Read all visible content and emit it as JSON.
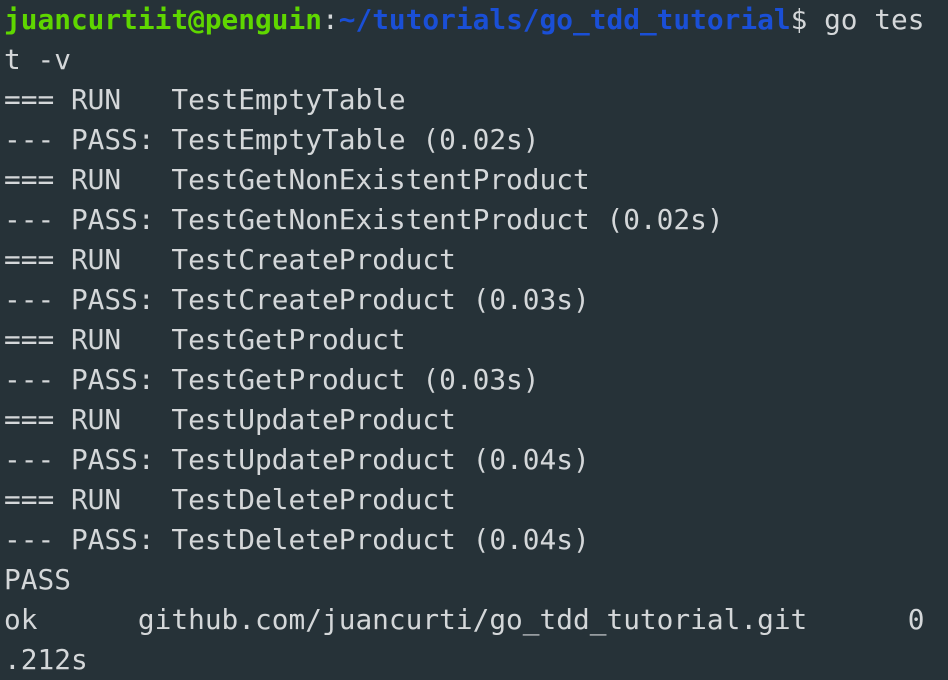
{
  "terminal": {
    "colors": {
      "background": "#263238",
      "foreground": "#d4d7d9",
      "user_host": "#5fd700",
      "path": "#1a4fd6"
    },
    "prompt": {
      "user_host": "juancurtiit@penguin",
      "colon": ":",
      "path": "~/tutorials/go_tdd_tutorial",
      "dollar": "$",
      "command_part1": " go tes"
    },
    "lines": [
      "t -v",
      "=== RUN   TestEmptyTable",
      "--- PASS: TestEmptyTable (0.02s)",
      "=== RUN   TestGetNonExistentProduct",
      "--- PASS: TestGetNonExistentProduct (0.02s)",
      "=== RUN   TestCreateProduct",
      "--- PASS: TestCreateProduct (0.03s)",
      "=== RUN   TestGetProduct",
      "--- PASS: TestGetProduct (0.03s)",
      "=== RUN   TestUpdateProduct",
      "--- PASS: TestUpdateProduct (0.04s)",
      "=== RUN   TestDeleteProduct",
      "--- PASS: TestDeleteProduct (0.04s)",
      "PASS",
      "ok      github.com/juancurti/go_tdd_tutorial.git      0",
      ".212s"
    ]
  }
}
